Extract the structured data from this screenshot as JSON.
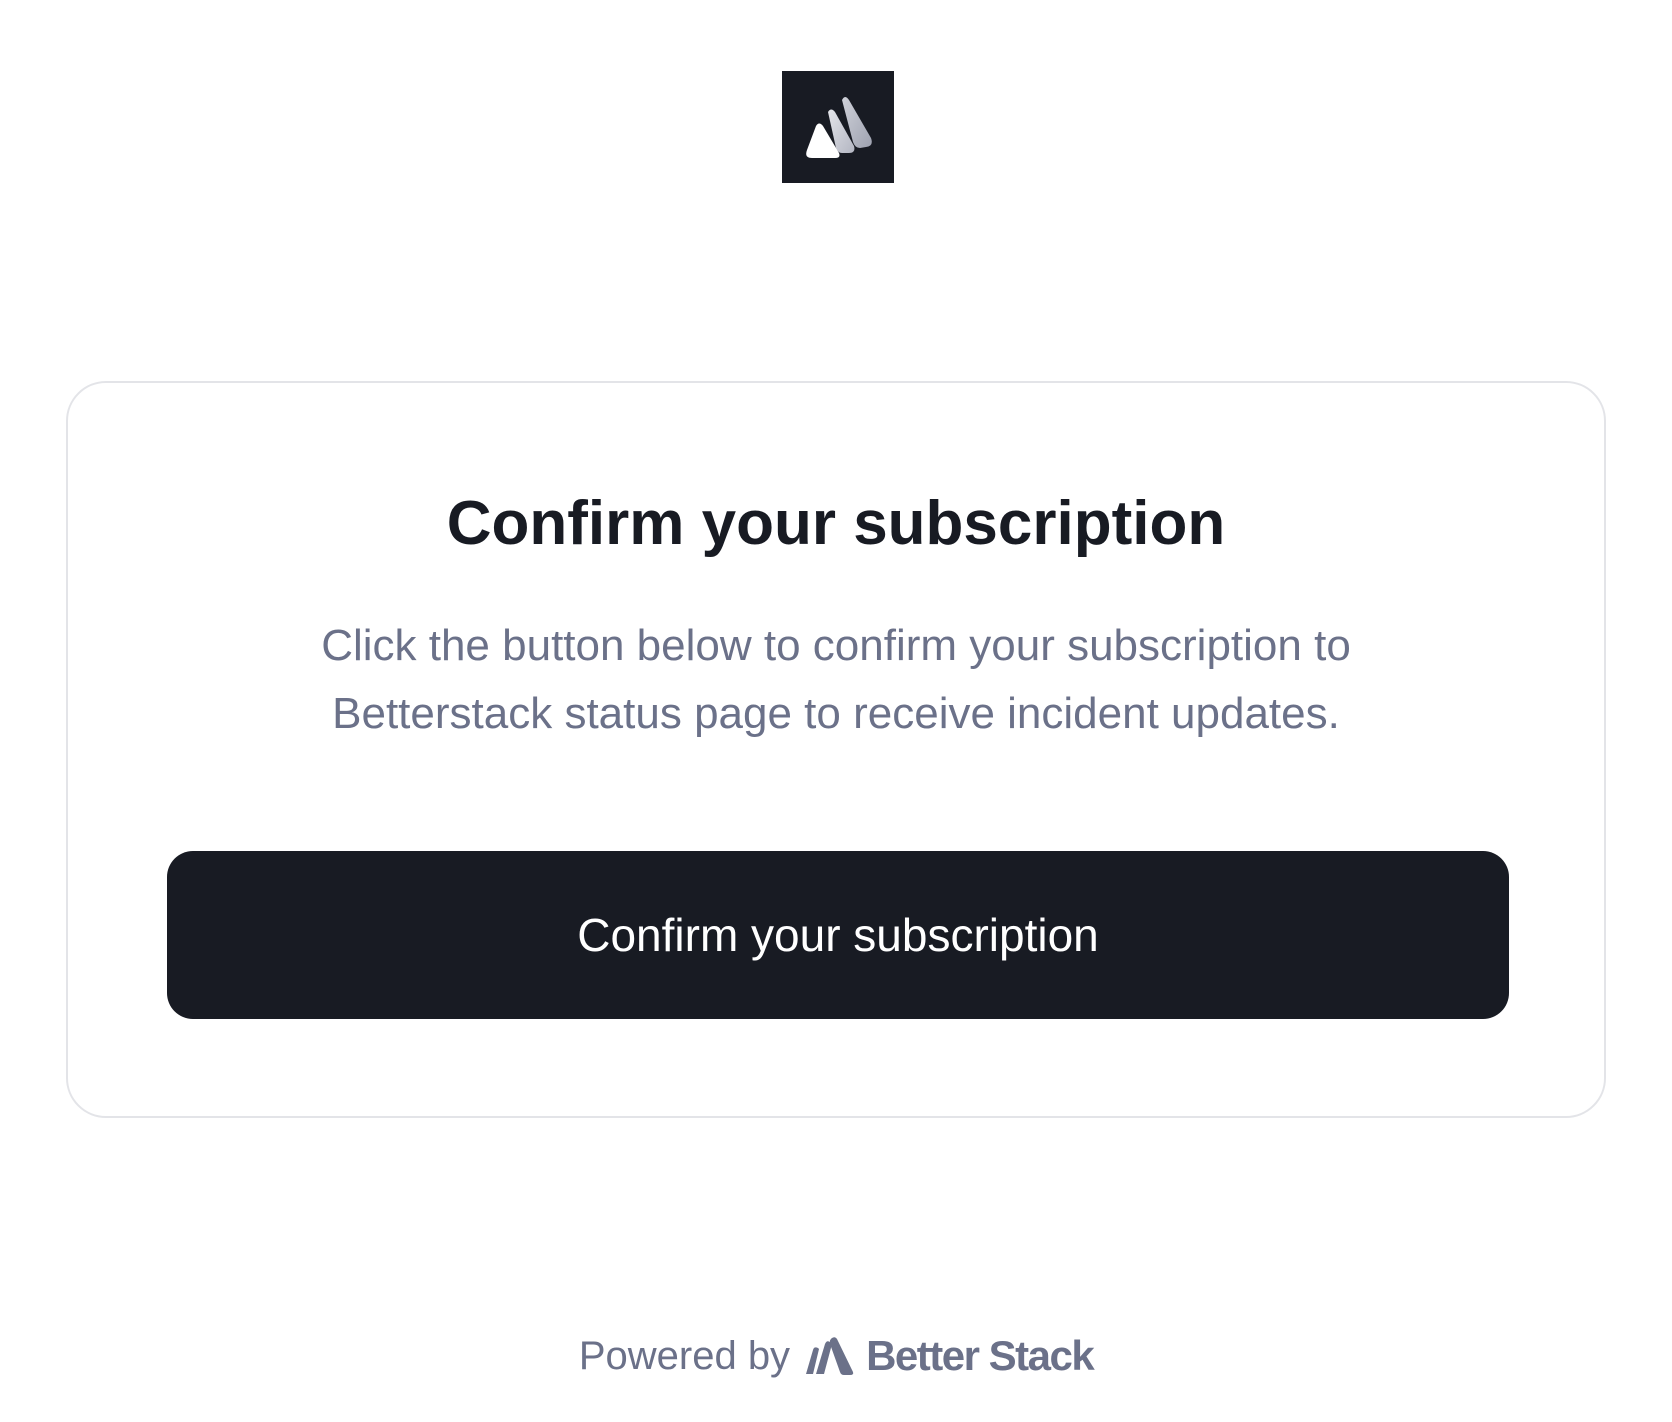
{
  "header": {
    "logo_icon": "betterstack-mountain-logo"
  },
  "card": {
    "title": "Confirm your subscription",
    "description": "Click the button below to confirm your subscription to Betterstack status page to receive incident updates.",
    "button_label": "Confirm your subscription"
  },
  "footer": {
    "powered_by": "Powered by",
    "brand_name": "Better Stack",
    "brand_icon": "betterstack-icon"
  },
  "colors": {
    "primary": "#181b23",
    "muted_text": "#6b7189",
    "border": "#e3e4e8",
    "background": "#ffffff"
  }
}
